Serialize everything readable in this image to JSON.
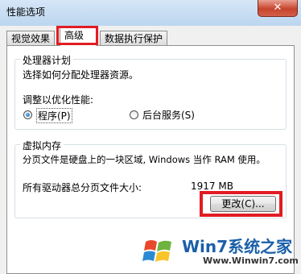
{
  "window": {
    "title": "性能选项",
    "close_label": "✕"
  },
  "tabs": [
    {
      "label": "视觉效果",
      "active": false
    },
    {
      "label": "高级",
      "active": true
    },
    {
      "label": "数据执行保护",
      "active": false
    }
  ],
  "processor": {
    "group_title": "处理器计划",
    "description": "选择如何分配处理器资源。",
    "optimize_label": "调整以优化性能:",
    "options": [
      {
        "label": "程序(P)",
        "selected": true
      },
      {
        "label": "后台服务(S)",
        "selected": false
      }
    ]
  },
  "virtual_memory": {
    "group_title": "虚拟内存",
    "description": "分页文件是硬盘上的一块区域, Windows 当作 RAM 使用。",
    "total_label": "所有驱动器总分页文件大小:",
    "total_value": "1917 MB",
    "change_button": "更改(C)..."
  },
  "watermark": {
    "brand_text": "Win7系统之家",
    "url": "Www.Winwin7.com"
  },
  "colors": {
    "highlight": "#e21c23",
    "brand": "#1b5faa"
  }
}
